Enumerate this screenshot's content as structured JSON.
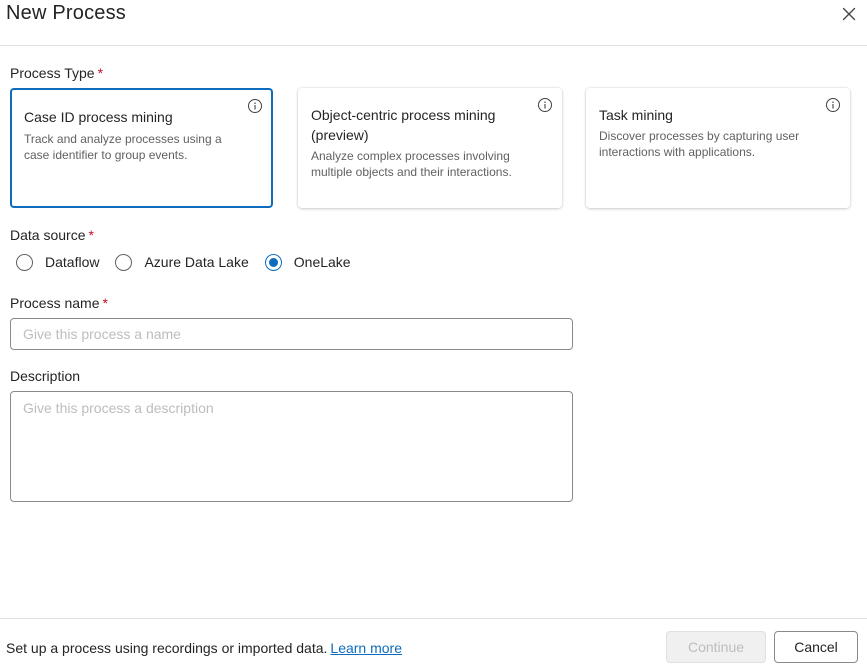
{
  "dialog": {
    "title": "New Process",
    "close_icon": "close-icon"
  },
  "process_type": {
    "label": "Process Type",
    "required_mark": "*",
    "cards": [
      {
        "title": "Case ID process mining",
        "description_lines": [
          "Track and analyze processes using a",
          "case identifier to group events."
        ],
        "selected": true
      },
      {
        "title_lines": [
          "Object-centric process mining",
          "(preview)"
        ],
        "description_lines": [
          "Analyze complex processes involving",
          "multiple objects and their interactions."
        ],
        "selected": false
      },
      {
        "title": "Task mining",
        "description_lines": [
          "Discover processes by capturing user",
          "interactions with applications."
        ],
        "selected": false
      }
    ],
    "info_icon": "info-icon"
  },
  "data_source": {
    "label": "Data source",
    "required_mark": "*",
    "options": [
      "Dataflow",
      "Azure Data Lake",
      "OneLake"
    ],
    "selected": "OneLake"
  },
  "process_name": {
    "label": "Process name",
    "required_mark": "*",
    "value": "",
    "placeholder": "Give this process a name"
  },
  "description": {
    "label": "Description",
    "value": "",
    "placeholder": "Give this process a description"
  },
  "footer": {
    "text": "Set up a process using recordings or imported data.",
    "learn_more": "Learn more",
    "continue_label": "Continue",
    "cancel_label": "Cancel"
  },
  "colors": {
    "accent": "#0f6cbd",
    "required": "#c50f1f",
    "disabled_text": "#bdbdbd"
  }
}
